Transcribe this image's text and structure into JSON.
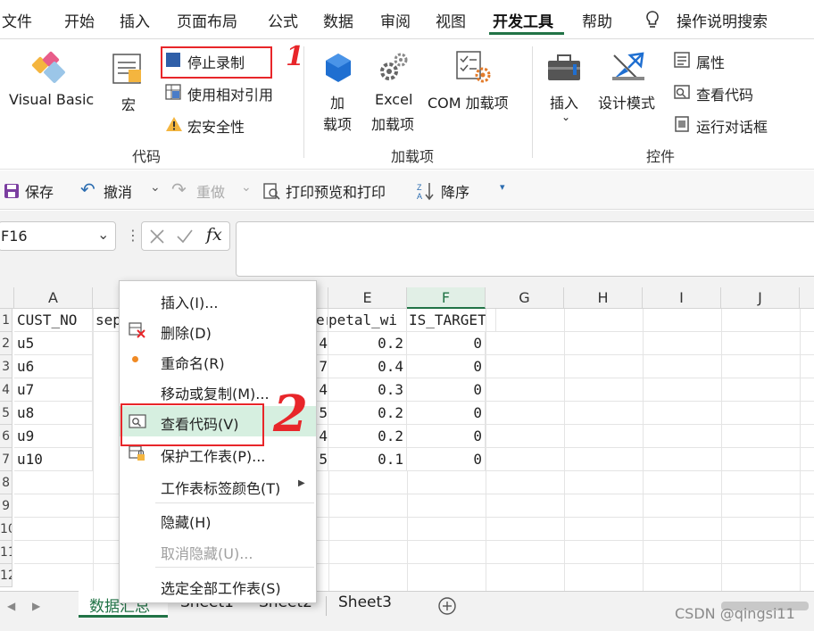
{
  "tabs": [
    "文件",
    "开始",
    "插入",
    "页面布局",
    "公式",
    "数据",
    "审阅",
    "视图",
    "开发工具",
    "帮助",
    "操作说明搜索"
  ],
  "ribbon": {
    "visual_basic": "Visual Basic",
    "macro": "宏",
    "stop_recording": "停止录制",
    "relative_ref": "使用相对引用",
    "macro_security": "宏安全性",
    "group_code": "代码",
    "addins_1": "加",
    "addins_2": "载项",
    "excel_addins_1": "Excel",
    "excel_addins_2": "加载项",
    "com_addins": "COM 加载项",
    "group_addins": "加载项",
    "insert": "插入",
    "design_mode": "设计模式",
    "properties": "属性",
    "view_code": "查看代码",
    "run_dialog": "运行对话框",
    "group_controls": "控件"
  },
  "qat": {
    "save": "保存",
    "undo": "撤消",
    "redo": "重做",
    "print_preview": "打印预览和打印",
    "sort_desc": "降序"
  },
  "formula_bar": {
    "name_box": "F16",
    "fx": "fx",
    "formula": ""
  },
  "columns": [
    "A",
    "E",
    "F",
    "G",
    "H",
    "I",
    "J"
  ],
  "rows": [
    "",
    "1",
    "2",
    "3",
    "4",
    "5",
    "6",
    "7",
    "8",
    "9",
    "10",
    "11",
    "12"
  ],
  "table": {
    "header": {
      "a": "CUST_NO",
      "b": "sep",
      "d": "er",
      "e": "petal_wi",
      "f": "IS_TARGET"
    },
    "body": [
      {
        "a": "u5",
        "d": "4",
        "e": "0.2",
        "f": "0"
      },
      {
        "a": "u6",
        "d": "7",
        "e": "0.4",
        "f": "0"
      },
      {
        "a": "u7",
        "d": "4",
        "e": "0.3",
        "f": "0"
      },
      {
        "a": "u8",
        "d": "5",
        "e": "0.2",
        "f": "0"
      },
      {
        "a": "u9",
        "d": "4",
        "e": "0.2",
        "f": "0"
      },
      {
        "a": "u10",
        "d": "5",
        "e": "0.1",
        "f": "0"
      }
    ]
  },
  "context_menu": {
    "insert": "插入(I)...",
    "delete": "删除(D)",
    "rename": "重命名(R)",
    "move_copy": "移动或复制(M)...",
    "view_code": "查看代码(V)",
    "protect": "保护工作表(P)...",
    "tab_color": "工作表标签颜色(T)",
    "hide": "隐藏(H)",
    "unhide": "取消隐藏(U)...",
    "select_all": "选定全部工作表(S)"
  },
  "sheets": [
    "数据汇总",
    "Sheet1",
    "Sheet2",
    "Sheet3"
  ],
  "annotations": {
    "mark1": "1",
    "mark2": "2"
  },
  "watermark": "CSDN @qingsi11",
  "colors": {
    "accent": "#217346",
    "annotation": "#e8262a",
    "menu_hover": "#d6efe0"
  }
}
